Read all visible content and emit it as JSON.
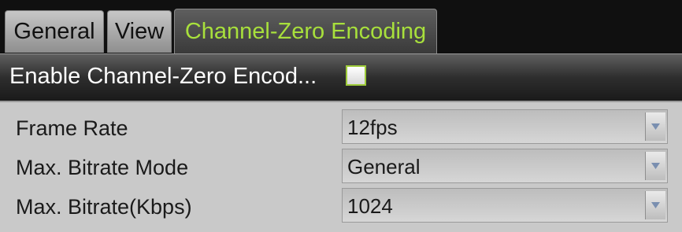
{
  "tabs": [
    {
      "label": "General",
      "active": false
    },
    {
      "label": "View",
      "active": false
    },
    {
      "label": "Channel-Zero Encoding",
      "active": true
    }
  ],
  "enable": {
    "label": "Enable Channel-Zero Encod...",
    "checked": false
  },
  "fields": [
    {
      "label": "Frame Rate",
      "value": "12fps"
    },
    {
      "label": "Max. Bitrate Mode",
      "value": "General"
    },
    {
      "label": "Max. Bitrate(Kbps)",
      "value": "1024"
    }
  ],
  "colors": {
    "active_tab_text": "#a8e03c",
    "form_bg": "#c9c9c9",
    "checkbox_border": "#9ecb3a"
  },
  "icons": {
    "dropdown": "chevron-down-icon"
  }
}
